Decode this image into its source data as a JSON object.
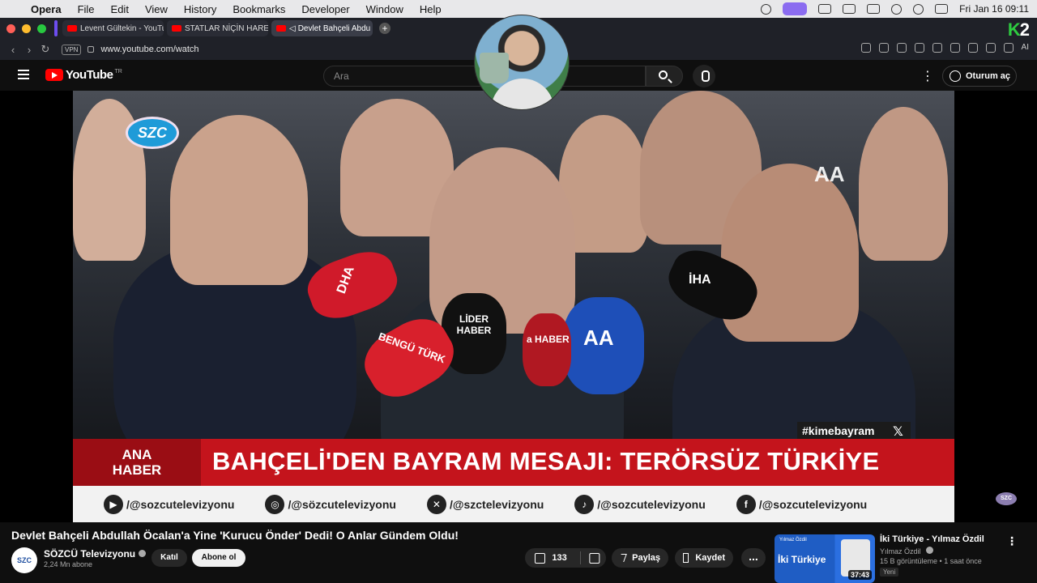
{
  "menubar": {
    "app": "Opera",
    "items": [
      "File",
      "Edit",
      "View",
      "History",
      "Bookmarks",
      "Developer",
      "Window",
      "Help"
    ],
    "clock": "Fri Jan 16  09:11"
  },
  "browser": {
    "tabs": [
      {
        "title": "Levent Gültekin - YouTube"
      },
      {
        "title": "STATLAR NİÇİN HAREKE"
      },
      {
        "title": "Devlet Bahçeli Abdu"
      }
    ],
    "url": "www.youtube.com/watch",
    "vpn_label": "VPN",
    "ai_label": "AI",
    "k2_logo": "K2"
  },
  "youtube": {
    "logo_text": "YouTube",
    "country": "TR",
    "search_placeholder": "Ara",
    "signin_label": "Oturum aç"
  },
  "video_frame": {
    "channel_logo": "SZC",
    "agency_logo": "AA",
    "mic_labels": [
      "DHA",
      "LİDER HABER",
      "BENGÜ TÜRK",
      "AA",
      "İHA",
      "a HABER"
    ],
    "hashtag": "#kimebayram",
    "lower_third_tag_line1": "ANA",
    "lower_third_tag_line2": "HABER",
    "headline": "BAHÇELİ'DEN BAYRAM MESAJI: TERÖRSÜZ TÜRKİYE",
    "socials": [
      {
        "icon": "youtube-icon",
        "handle": "/@sozcutelevizyonu"
      },
      {
        "icon": "instagram-icon",
        "handle": "/@sözcutelevizyonu"
      },
      {
        "icon": "x-icon",
        "handle": "/@szctelevizyonu"
      },
      {
        "icon": "tiktok-icon",
        "handle": "/@sozcutelevizyonu"
      },
      {
        "icon": "facebook-icon",
        "handle": "/@sozcutelevizyonu"
      }
    ],
    "corner_logo": "SZC"
  },
  "video_info": {
    "title": "Devlet Bahçeli Abdullah Öcalan'a Yine 'Kurucu Önder' Dedi! O Anlar Gündem Oldu!",
    "channel_name": "SÖZCÜ Televizyonu",
    "channel_avatar": "SZC",
    "subscribers": "2,24 Mn abone",
    "join_label": "Katıl",
    "subscribe_label": "Abone ol",
    "likes": "133",
    "share_label": "Paylaş",
    "save_label": "Kaydet",
    "more_label": "..."
  },
  "recommendation": {
    "thumb_small_text": "Yılmaz Özdil",
    "thumb_big_text": "İki Türkiye",
    "duration": "37:43",
    "title": "İki Türkiye - Yılmaz Özdil",
    "channel": "Yılmaz Özdil",
    "meta": "15 B görüntüleme • 1 saat önce",
    "badge": "Yeni"
  },
  "colors": {
    "yt_red": "#ff0000",
    "headline_red": "#c4141c",
    "dark_bg": "#0f0f0f"
  }
}
